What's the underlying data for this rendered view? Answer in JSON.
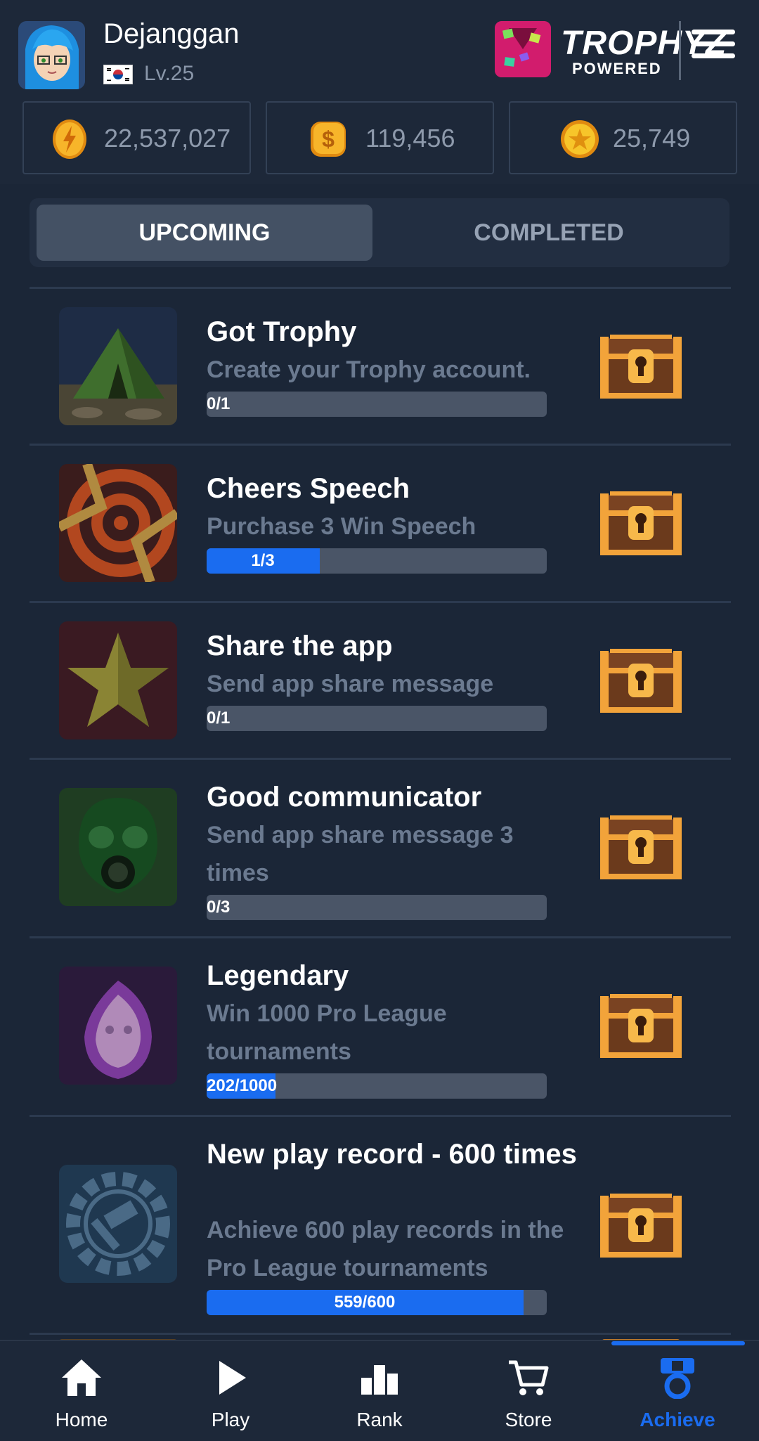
{
  "profile": {
    "username": "Dejanggan",
    "level": "Lv.25",
    "flag_icon": "korea-flag-icon"
  },
  "brand": {
    "name": "TROPHYZ",
    "sub": "POWERED"
  },
  "currencies": [
    {
      "icon": "energy-coin-icon",
      "value": "22,537,027"
    },
    {
      "icon": "dollar-coin-icon",
      "value": "119,456"
    },
    {
      "icon": "star-coin-icon",
      "value": "25,749"
    }
  ],
  "tabs": {
    "upcoming": "UPCOMING",
    "completed": "COMPLETED"
  },
  "achievements": [
    {
      "title": "Got Trophy",
      "desc": "Create your Trophy account.",
      "progress_text": "0/1",
      "progress": 0.0,
      "icon": "tent-icon"
    },
    {
      "title": "Cheers Speech",
      "desc": "Purchase 3 Win Speech",
      "progress_text": "1/3",
      "progress": 0.333,
      "icon": "target-icon"
    },
    {
      "title": "Share the app",
      "desc": "Send app share message",
      "progress_text": "0/1",
      "progress": 0.0,
      "icon": "star-icon"
    },
    {
      "title": "Good communicator",
      "desc": "Send app share message 3 times",
      "progress_text": "0/3",
      "progress": 0.0,
      "icon": "gas-mask-icon"
    },
    {
      "title": "Legendary",
      "desc": "Win 1000 Pro League tournaments",
      "progress_text": "202/1000",
      "progress": 0.202,
      "icon": "ghost-flame-icon"
    },
    {
      "title": "New play record - 600 times",
      "desc": "Achieve 600 play records in the Pro League tournaments",
      "progress_text": "559/600",
      "progress": 0.932,
      "icon": "gear-hammer-icon"
    }
  ],
  "nav": [
    {
      "label": "Home",
      "icon": "home-icon"
    },
    {
      "label": "Play",
      "icon": "play-icon"
    },
    {
      "label": "Rank",
      "icon": "rank-icon"
    },
    {
      "label": "Store",
      "icon": "cart-icon"
    },
    {
      "label": "Achieve",
      "icon": "medal-icon"
    }
  ],
  "colors": {
    "background": "#1b2637",
    "accent": "#1a6cf0",
    "muted_text": "#6b7a90"
  }
}
